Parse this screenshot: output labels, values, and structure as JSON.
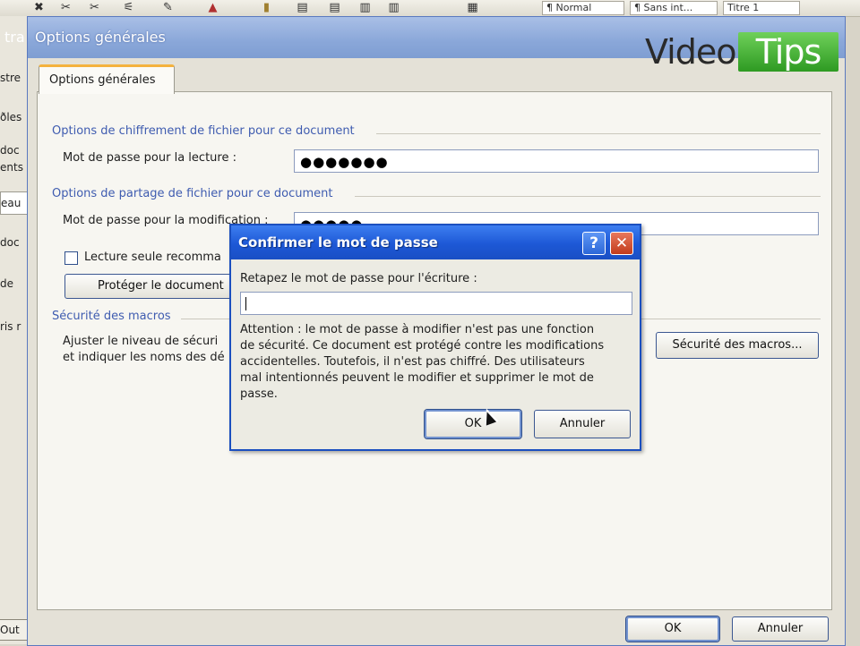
{
  "background_app": {
    "toolbar": {
      "style_box_1": "¶ Normal",
      "style_box_2": "¶ Sans int...",
      "style_box_3": "Titre 1"
    },
    "left_pane": {
      "items": [
        "stre",
        "ðles",
        "doc",
        "ents",
        "eau",
        "doc",
        "de",
        "ris r"
      ],
      "bottom_label": "Out"
    },
    "title_fragment": "tra"
  },
  "main_dialog": {
    "title": "Options générales",
    "tab_label": "Options générales",
    "encryption_group": "Options de chiffrement de fichier pour ce document",
    "read_password_label": "Mot de passe pour la lecture :",
    "read_password_value": "●●●●●●●",
    "sharing_group": "Options de partage de fichier pour ce document",
    "modify_password_label": "Mot de passe pour la modification :",
    "modify_password_value": "●●●●●",
    "readonly_label": "Lecture seule recomma",
    "protect_button": "Protéger le document",
    "macro_group": "Sécurité des macros",
    "macro_text_line1": "Ajuster le niveau de sécuri",
    "macro_text_line2": "et indiquer les noms des dé",
    "macro_button": "Sécurité des macros...",
    "ok_button": "OK",
    "cancel_button": "Annuler"
  },
  "confirm_dialog": {
    "title": "Confirmer le mot de passe",
    "prompt": "Retapez le mot de passe pour l'écriture :",
    "password_value": "",
    "warning_lines": [
      "Attention : le mot de passe à modifier n'est pas une fonction",
      "de sécurité. Ce document est protégé contre les modifications",
      "accidentelles. Toutefois, il n'est pas chiffré. Des utilisateurs",
      "mal intentionnés peuvent le modifier et supprimer le mot de",
      "passe."
    ],
    "ok_button": "OK",
    "cancel_button": "Annuler",
    "help_glyph": "?",
    "close_glyph": "✕"
  },
  "watermark": {
    "word1": "Video",
    "word2": "Tips"
  },
  "colors": {
    "xp_title_blue": "#1d58d6",
    "classic_title_blue": "#8aa7d9",
    "group_label_blue": "#3f5cb0",
    "tips_green": "#2e9a22",
    "close_red": "#c23b1c"
  },
  "icons": [
    "bold-icon",
    "cut-icon",
    "copy-icon",
    "paste-icon",
    "format-painter-icon",
    "font-color-icon",
    "highlight-icon",
    "bullets-icon",
    "numbering-icon",
    "indent-icon",
    "outdent-icon",
    "help-icon",
    "close-icon",
    "mouse-pointer-icon"
  ]
}
